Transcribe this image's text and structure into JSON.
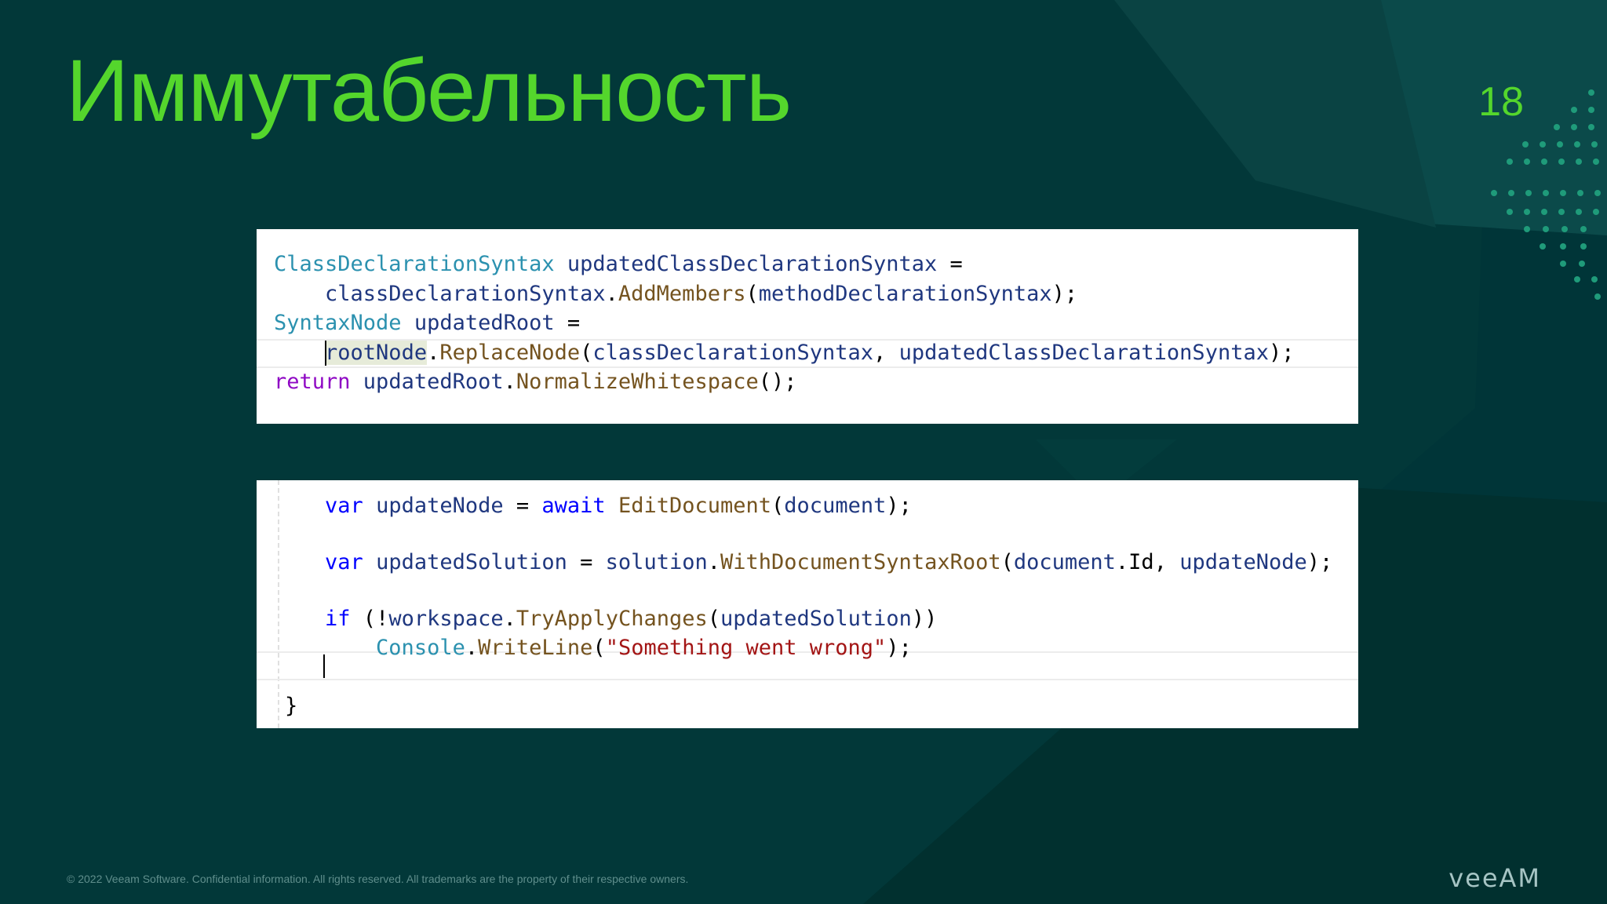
{
  "slide": {
    "title": "Иммутабельность",
    "page_number": "18",
    "footer": "© 2022 Veeam Software. Confidential information. All rights reserved. All trademarks are the property of their respective owners.",
    "logo": "veeAM"
  },
  "colors": {
    "background": "#003538",
    "accent": "#54d62c",
    "code_background": "#ffffff"
  },
  "code1": [
    [
      "ClassDeclarationSyntax",
      " updatedClassDeclarationSyntax ",
      "="
    ],
    [
      "    classDeclarationSyntax",
      ".",
      "AddMembers",
      "(",
      "methodDeclarationSyntax",
      ");"
    ],
    [
      "SyntaxNode",
      " updatedRoot ",
      "="
    ],
    [
      "    ",
      "rootNode",
      ".",
      "ReplaceNode",
      "(",
      "classDeclarationSyntax",
      ", ",
      "updatedClassDeclarationSyntax",
      ");"
    ],
    [
      "return",
      " updatedRoot",
      ".",
      "NormalizeWhitespace",
      "();"
    ]
  ],
  "code2": [
    [
      "    ",
      "var",
      " updateNode ",
      "= ",
      "await",
      " ",
      "EditDocument",
      "(",
      "document",
      ");"
    ],
    [
      "    ",
      "var",
      " updatedSolution ",
      "= ",
      "solution",
      ".",
      "WithDocumentSyntaxRoot",
      "(",
      "document",
      ".Id, ",
      "updateNode",
      ");"
    ],
    [
      "    ",
      "if",
      " (!",
      "workspace",
      ".",
      "TryApplyChanges",
      "(",
      "updatedSolution",
      "))"
    ],
    [
      "        ",
      "Console",
      ".",
      "WriteLine",
      "(",
      "\"Something went wrong\"",
      ");"
    ],
    [
      "}"
    ]
  ]
}
